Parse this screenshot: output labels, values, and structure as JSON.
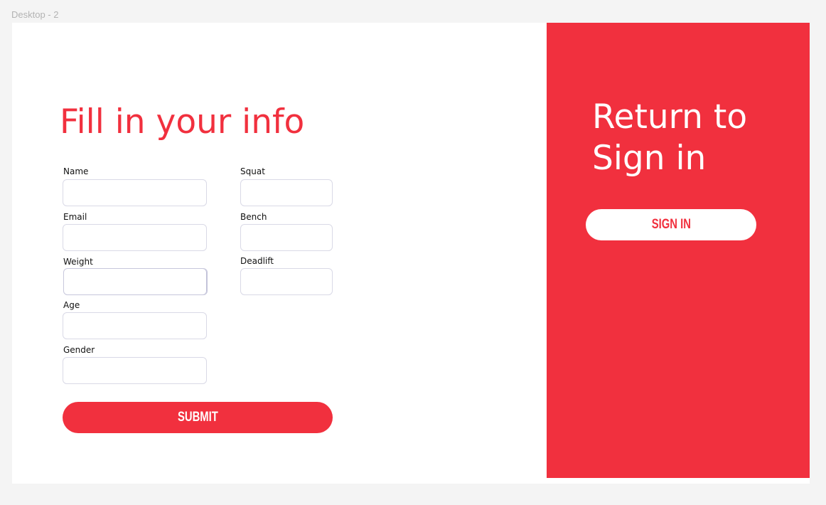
{
  "frame": {
    "label": "Desktop - 2"
  },
  "form": {
    "title": "Fill in your info",
    "fields": {
      "name": {
        "label": "Name",
        "value": "",
        "placeholder": ""
      },
      "email": {
        "label": "Email",
        "value": "",
        "placeholder": ""
      },
      "weight": {
        "label": "Weight",
        "value": "",
        "placeholder": ""
      },
      "age": {
        "label": "Age",
        "value": "",
        "placeholder": ""
      },
      "gender": {
        "label": "Gender",
        "value": "",
        "placeholder": ""
      },
      "squat": {
        "label": "Squat",
        "value": "",
        "placeholder": ""
      },
      "bench": {
        "label": "Bench",
        "value": "",
        "placeholder": ""
      },
      "deadlift": {
        "label": "Deadlift",
        "value": "",
        "placeholder": ""
      }
    },
    "submit_label": "SUBMIT"
  },
  "side_panel": {
    "title": "Return to Sign in",
    "signin_label": "SIGN IN"
  },
  "colors": {
    "accent": "#f1303e",
    "background": "#ffffff",
    "canvas": "#f4f4f4"
  }
}
